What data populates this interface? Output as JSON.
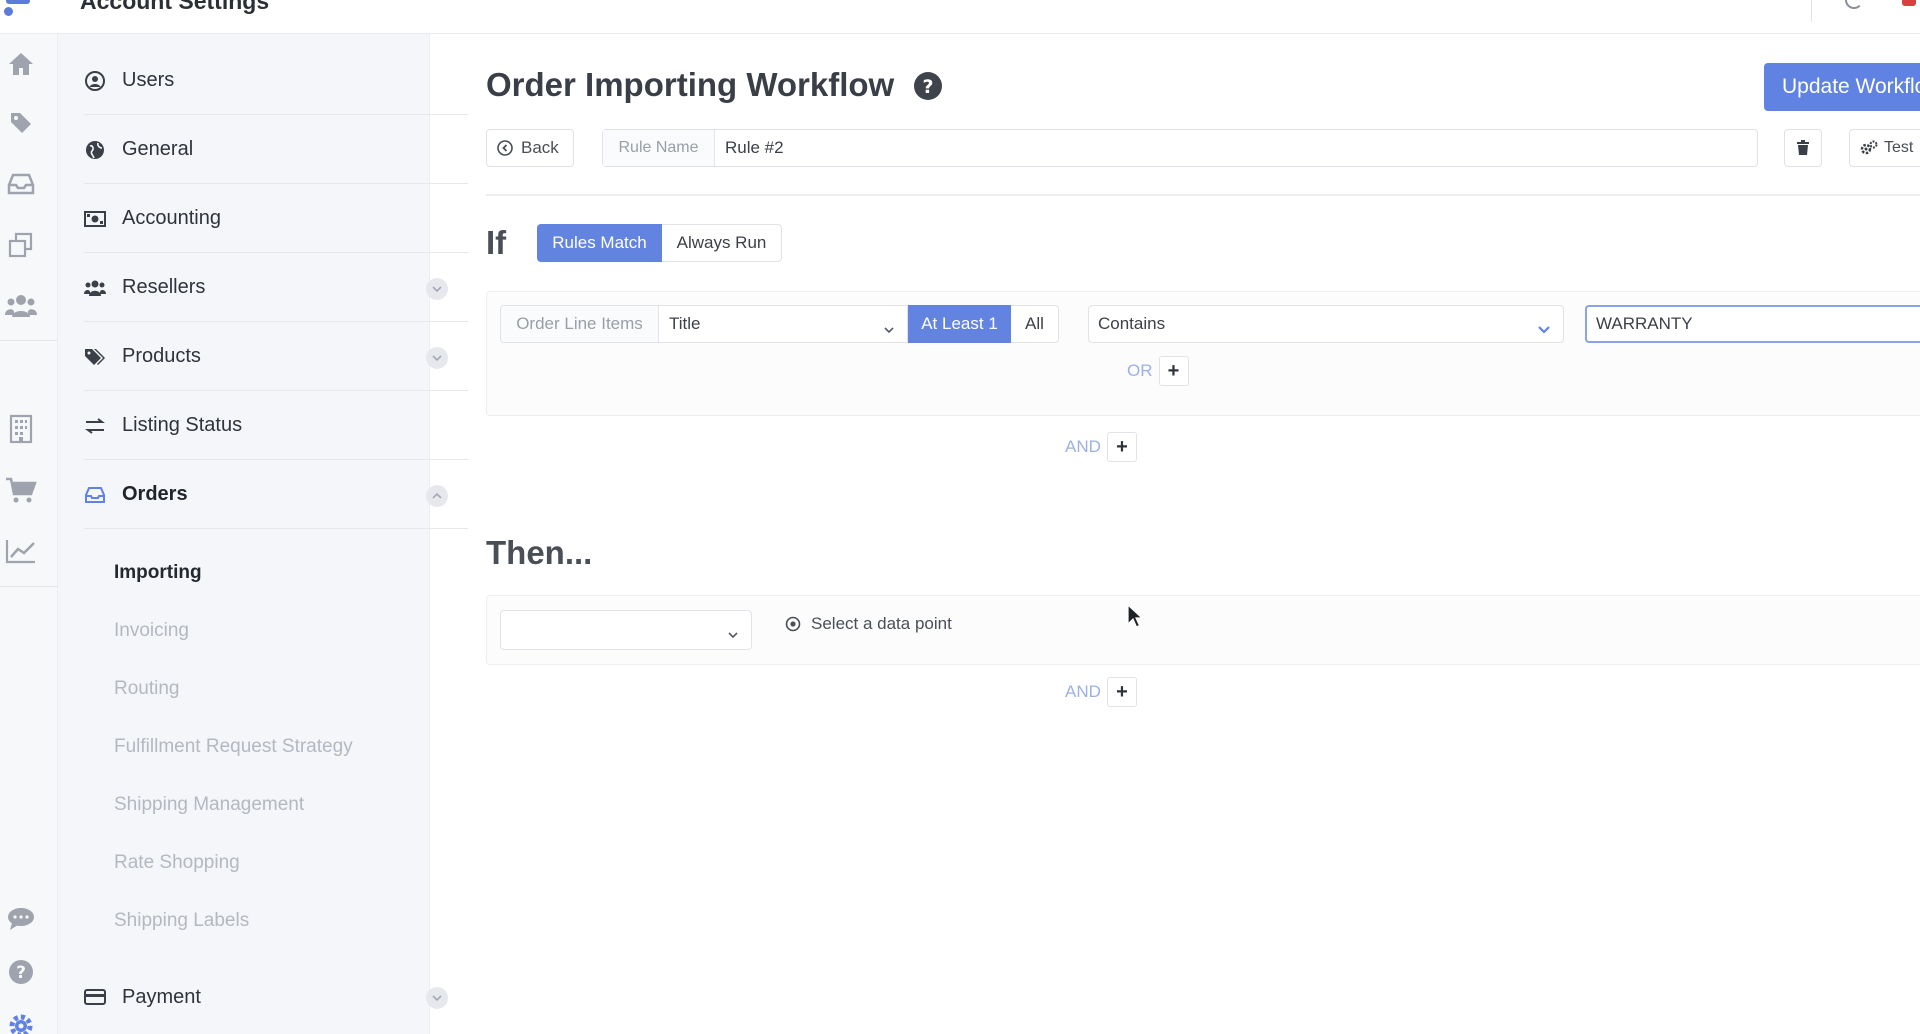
{
  "header": {
    "title": "Account Settings"
  },
  "rail": {
    "icons": [
      "home-icon",
      "tag-icon",
      "inbox-icon",
      "copy-icon",
      "users-icon",
      "building-icon",
      "cart-icon",
      "chart-icon",
      "chat-icon",
      "help-icon",
      "gear-icon"
    ]
  },
  "sidebar": {
    "items": [
      {
        "label": "Users",
        "icon": "user-circle-icon"
      },
      {
        "label": "General",
        "icon": "globe-icon"
      },
      {
        "label": "Accounting",
        "icon": "money-icon"
      },
      {
        "label": "Resellers",
        "icon": "users-icon"
      },
      {
        "label": "Products",
        "icon": "tags-icon"
      },
      {
        "label": "Listing Status",
        "icon": "exchange-icon"
      },
      {
        "label": "Orders",
        "icon": "inbox-icon"
      },
      {
        "label": "Payment",
        "icon": "credit-card-icon"
      }
    ],
    "orders_sub": [
      "Importing",
      "Invoicing",
      "Routing",
      "Fulfillment Request Strategy",
      "Shipping Management",
      "Rate Shopping",
      "Shipping Labels"
    ]
  },
  "main": {
    "title": "Order Importing Workflow",
    "update_button": "Update Workflow",
    "back_button": "Back",
    "rule_name_label": "Rule Name",
    "rule_name_value": "Rule #2",
    "test_button": "Test",
    "if_label": "If",
    "mode_options": [
      "Rules Match",
      "Always Run"
    ],
    "condition": {
      "scope": "Order Line Items",
      "field": "Title",
      "quantifier_options": [
        "At Least 1",
        "All"
      ],
      "operator": "Contains",
      "value": "WARRANTY"
    },
    "or_label": "OR",
    "and_label": "AND",
    "then_label": "Then...",
    "then_data_point": "Select a data point",
    "then_and_label": "AND",
    "plus_symbol": "+"
  },
  "colors": {
    "accent": "#6283e0",
    "accent_light": "#9db0e4",
    "sidebar_bg": "#f5f6f9"
  }
}
